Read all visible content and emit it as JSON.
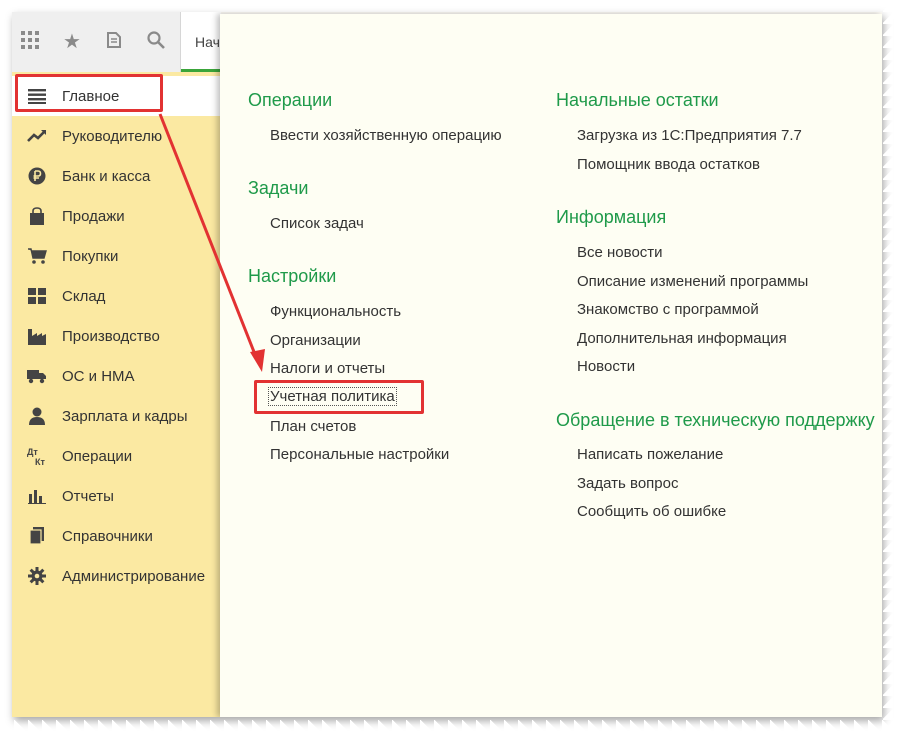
{
  "toolbar": {
    "tab_label": "Нач",
    "icons": [
      "apps-grid-icon",
      "star-icon",
      "history-icon",
      "search-icon"
    ]
  },
  "sidebar": {
    "items": [
      {
        "label": "Главное",
        "icon": "menu-lines-icon",
        "active": true
      },
      {
        "label": "Руководителю",
        "icon": "trend-icon"
      },
      {
        "label": "Банк и касса",
        "icon": "ruble-icon"
      },
      {
        "label": "Продажи",
        "icon": "bag-icon"
      },
      {
        "label": "Покупки",
        "icon": "cart-icon"
      },
      {
        "label": "Склад",
        "icon": "warehouse-icon"
      },
      {
        "label": "Производство",
        "icon": "factory-icon"
      },
      {
        "label": "ОС и НМА",
        "icon": "truck-icon"
      },
      {
        "label": "Зарплата и кадры",
        "icon": "person-icon"
      },
      {
        "label": "Операции",
        "icon": "dt-kt-icon"
      },
      {
        "label": "Отчеты",
        "icon": "bar-chart-icon"
      },
      {
        "label": "Справочники",
        "icon": "books-icon"
      },
      {
        "label": "Администрирование",
        "icon": "gear-icon"
      }
    ]
  },
  "menu": {
    "left": [
      {
        "title": "Операции",
        "items": [
          "Ввести хозяйственную операцию"
        ]
      },
      {
        "title": "Задачи",
        "items": [
          "Список задач"
        ]
      },
      {
        "title": "Настройки",
        "items": [
          "Функциональность",
          "Организации",
          "Налоги и отчеты",
          "Учетная политика",
          "План счетов",
          "Персональные настройки"
        ]
      }
    ],
    "right": [
      {
        "title": "Начальные остатки",
        "items": [
          "Загрузка из 1С:Предприятия 7.7",
          "Помощник ввода остатков"
        ]
      },
      {
        "title": "Информация",
        "items": [
          "Все новости",
          "Описание изменений программы",
          "Знакомство с программой",
          "Дополнительная информация",
          "Новости"
        ]
      },
      {
        "title": "Обращение в техническую поддержку",
        "items": [
          "Написать пожелание",
          "Задать вопрос",
          "Сообщить об ошибке"
        ]
      }
    ]
  },
  "colors": {
    "accent_green": "#1f9a4a",
    "sidebar_bg": "#fbe9a2",
    "highlight_red": "#e23232"
  }
}
